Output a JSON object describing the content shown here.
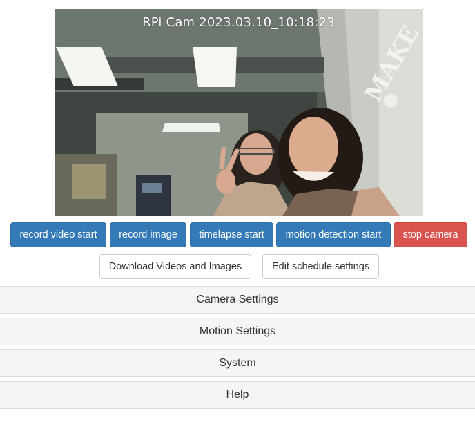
{
  "camera": {
    "overlay": "RPi Cam 2023.03.10_10:18:23",
    "wall_sign": "MAKE"
  },
  "controls": {
    "record_video_start": "record video start",
    "record_image": "record image",
    "timelapse_start": "timelapse start",
    "motion_detection_start": "motion detection start",
    "stop_camera": "stop camera"
  },
  "links": {
    "download": "Download Videos and Images",
    "schedule": "Edit schedule settings"
  },
  "panels": [
    {
      "label": "Camera Settings"
    },
    {
      "label": "Motion Settings"
    },
    {
      "label": "System"
    },
    {
      "label": "Help"
    }
  ],
  "colors": {
    "primary": "#337ab7",
    "danger": "#d9534f",
    "panel_bg": "#f5f5f5"
  }
}
